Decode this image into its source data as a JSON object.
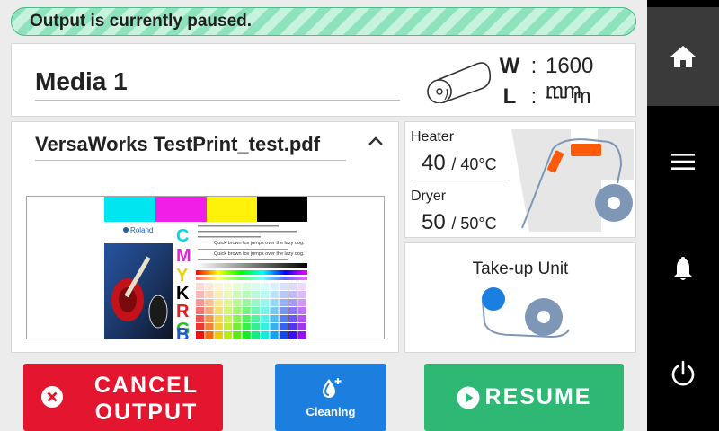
{
  "status": {
    "message": "Output is currently paused."
  },
  "media": {
    "name": "Media 1",
    "width_label": "W",
    "width_value": "1600 mm",
    "length_label": "L",
    "length_value": "--- m",
    "separator": ":"
  },
  "job": {
    "filename": "VersaWorks TestPrint_test.pdf",
    "preview": {
      "brand": "Roland",
      "cmyk_letters": [
        "C",
        "M",
        "Y",
        "K"
      ],
      "rgb_letters": [
        "R",
        "G",
        "B"
      ],
      "sample_text": "Quick brown fox jumps over the lazy dog."
    }
  },
  "heater": {
    "label": "Heater",
    "current": "40",
    "target": "/ 40°C"
  },
  "dryer": {
    "label": "Dryer",
    "current": "50",
    "target": "/ 50°C"
  },
  "takeup": {
    "label": "Take-up Unit"
  },
  "buttons": {
    "cancel_line1": "CANCEL",
    "cancel_line2": "OUTPUT",
    "cleaning": "Cleaning",
    "resume": "RESUME"
  },
  "sidebar": {
    "items": [
      "home-icon",
      "menu-icon",
      "bell-icon",
      "power-icon"
    ]
  },
  "colors": {
    "cancel": "#e4152f",
    "cleaning": "#1c7fe0",
    "resume": "#2eb873",
    "status": "#8ee3bd",
    "accent_orange": "#ff5a0a",
    "accent_blue": "#1c7fe0"
  }
}
